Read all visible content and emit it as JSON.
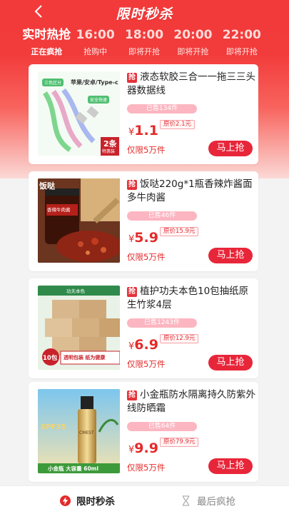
{
  "header": {
    "title": "限时秒杀",
    "back_icon": "back-arrow-icon"
  },
  "tabs": [
    {
      "time": "实时热抢",
      "status": "正在疯抢",
      "active": true
    },
    {
      "time": "16:00",
      "status": "抢购中",
      "active": false
    },
    {
      "time": "18:00",
      "status": "即将开抢",
      "active": false
    },
    {
      "time": "20:00",
      "status": "即将开抢",
      "active": false
    },
    {
      "time": "22:00",
      "status": "即将开抢",
      "active": false
    }
  ],
  "products": [
    {
      "tag": "抢",
      "title": "液态软胶三合一一拖三三头器数据线",
      "sold": "已售134件",
      "yen": "¥",
      "price": "1.1",
      "original": "原价2.1元",
      "limit": "仅限5万件",
      "buy": "马上抢",
      "image_text": {
        "badge": "三色区分",
        "head": "苹果/安卓/Type-c",
        "sub": "安全快速",
        "count": "2条",
        "count_sub": "特惠装"
      }
    },
    {
      "tag": "抢",
      "title": "饭哒220g*1瓶香辣炸酱面多牛肉酱",
      "sold": "已售46件",
      "yen": "¥",
      "price": "5.9",
      "original": "原价15.9元",
      "limit": "仅限5万件",
      "buy": "马上抢",
      "image_text": {
        "brand": "饭哒",
        "label": "香辣牛肉酱"
      }
    },
    {
      "tag": "抢",
      "title": "植护功夫本色10包抽纸原生竹浆4层",
      "sold": "已售1243件",
      "yen": "¥",
      "price": "6.9",
      "original": "原价12.9元",
      "limit": "仅限5万件",
      "buy": "马上抢",
      "image_text": {
        "brand": "功夫本色",
        "count": "10包",
        "pack": "透明包装 纸为健康"
      }
    },
    {
      "tag": "抢",
      "title": "小金瓶防水隔离持久防紫外线防晒霜",
      "sold": "已售64件",
      "yen": "¥",
      "price": "9.9",
      "original": "原价79.9元",
      "limit": "仅限5万件",
      "buy": "马上抢",
      "image_text": {
        "spf": "SPF35",
        "bottle": "CMEST",
        "foot": "小金瓶 大容量 60ml"
      }
    }
  ],
  "bottom_nav": [
    {
      "label": "限时秒杀",
      "icon": "lightning-icon",
      "active": true
    },
    {
      "label": "最后疯抢",
      "icon": "hourglass-icon",
      "active": false
    }
  ],
  "colors": {
    "accent": "#e8263a",
    "price": "#e42a2a",
    "header": "#f33a3a"
  }
}
